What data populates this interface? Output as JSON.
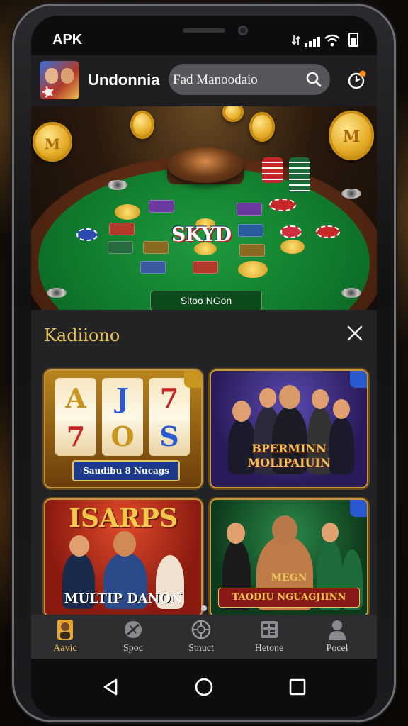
{
  "status_bar": {
    "carrier": "APK"
  },
  "app_bar": {
    "brand": "Undonnia",
    "search": {
      "value": "Fad Manoodaio",
      "placeholder": "Fad Manoodaio"
    }
  },
  "hero": {
    "center_logo": "SKYD",
    "coin_label": "M",
    "table_label": "Sltoo NGon"
  },
  "panel": {
    "title": "Kadiiono",
    "games": [
      {
        "banner": "Saudibu 8 Nucags",
        "symbols_top": [
          "A",
          "J",
          "7"
        ],
        "symbols_bottom": [
          "7",
          "O",
          "S"
        ]
      },
      {
        "banner": "BPERMINN MOLIPAIUIN"
      },
      {
        "headline": "ISARPS",
        "banner": "MULTIP DANON"
      },
      {
        "headline": "MEGN",
        "banner": "TAODIU NGUAGJIINN"
      }
    ]
  },
  "tab_bar": {
    "tabs": [
      {
        "label": "Aavic",
        "icon": "avatar-icon",
        "active": true
      },
      {
        "label": "Spoc",
        "icon": "sports-icon",
        "active": false
      },
      {
        "label": "Stnuct",
        "icon": "compass-icon",
        "active": false
      },
      {
        "label": "Hetone",
        "icon": "grid-icon",
        "active": false
      },
      {
        "label": "Pocel",
        "icon": "profile-icon",
        "active": false
      }
    ]
  },
  "colors": {
    "accent_gold": "#e8c35a",
    "felt_green": "#107a2c",
    "notification_dot": "#ff8a1a"
  }
}
